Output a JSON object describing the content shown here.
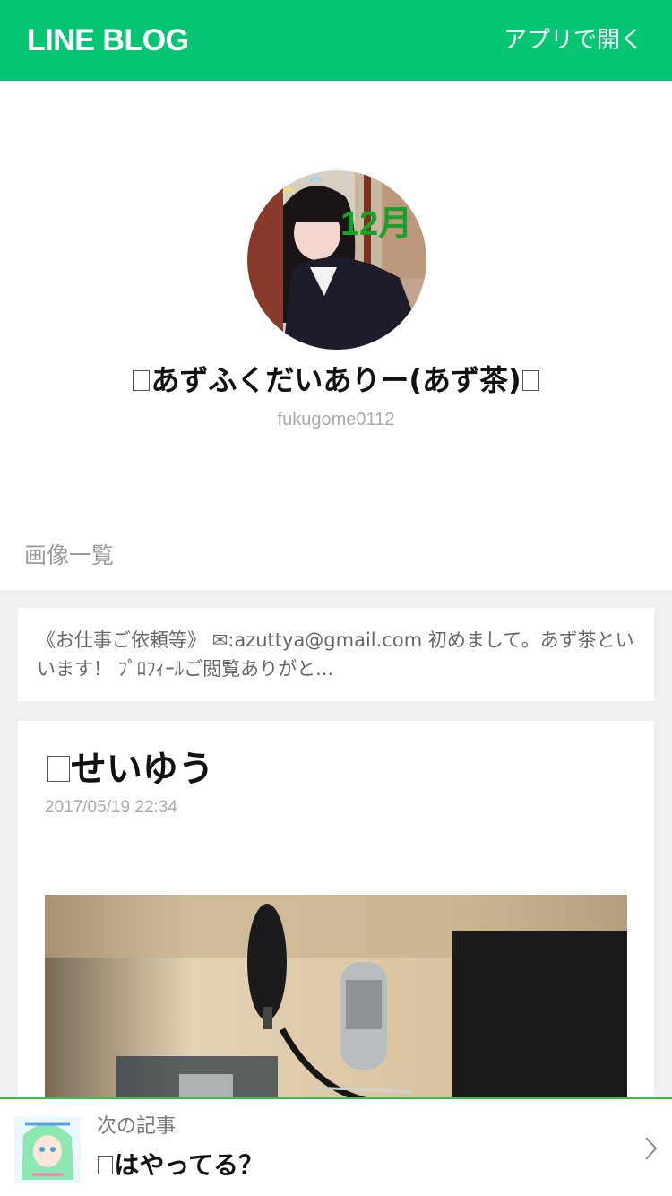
{
  "header": {
    "logo": "LINE BLOG",
    "open_app": "アプリで開く"
  },
  "profile": {
    "avatar_overlay": "12月",
    "name": "あずふくだいありー(あず茶)",
    "blog_id": "fukugome0112",
    "images_link": "画像一覧"
  },
  "intro": {
    "text": "《お仕事ご依頼等》 ✉:azuttya@gmail.com 初めまして。あず茶といいます！ ﾌﾟﾛﾌｨｰﾙご閲覧ありがと..."
  },
  "article": {
    "title": "せいゆう",
    "date": "2017/05/19 22:34"
  },
  "next": {
    "label": "次の記事",
    "title": "はやってる？"
  },
  "colors": {
    "brand_green": "#06c574",
    "divider_green": "#3dbd4c"
  }
}
